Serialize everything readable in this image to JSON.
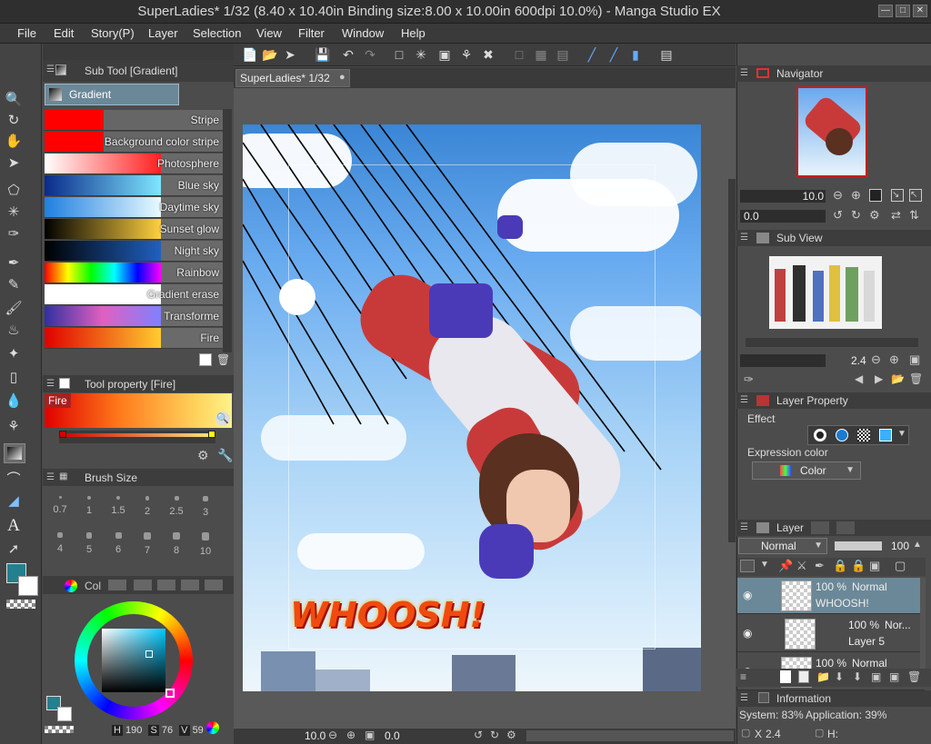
{
  "window": {
    "title": "SuperLadies* 1/32 (8.40 x 10.40in Binding size:8.00 x 10.00in 600dpi 10.0%)  - Manga Studio EX"
  },
  "menu": [
    "File",
    "Edit",
    "Story(P)",
    "Layer",
    "Selection",
    "View",
    "Filter",
    "Window",
    "Help"
  ],
  "subtool": {
    "panel_title": "Sub Tool [Gradient]",
    "active": "Gradient",
    "gradients": [
      {
        "name": "Stripe",
        "colors": [
          "#ff0000",
          "#ff0000"
        ]
      },
      {
        "name": "Background color stripe",
        "colors": [
          "#ff0000",
          "#ff0000"
        ]
      },
      {
        "name": "Photosphere",
        "colors": [
          "#ffffff",
          "#ff2020"
        ]
      },
      {
        "name": "Blue sky",
        "colors": [
          "#0a2a8a",
          "#7fe6ff"
        ]
      },
      {
        "name": "Daytime sky",
        "colors": [
          "#1f7fe0",
          "#e8fbff"
        ]
      },
      {
        "name": "Sunset glow",
        "colors": [
          "#000000",
          "#ffd040"
        ]
      },
      {
        "name": "Night sky",
        "colors": [
          "#000000",
          "#2060c0"
        ]
      },
      {
        "name": "Rainbow",
        "colors": [
          "#ff0000",
          "#ffff00",
          "#00ff00",
          "#00ffff",
          "#0000ff",
          "#ff00ff"
        ]
      },
      {
        "name": "Gradient erase",
        "colors": [
          "#ffffff",
          "#ffffff"
        ]
      },
      {
        "name": "Transforme",
        "colors": [
          "#3030a0",
          "#e060c0",
          "#8080ff"
        ]
      },
      {
        "name": "Fire",
        "colors": [
          "#e00000",
          "#ffcc30"
        ]
      }
    ]
  },
  "tool_property": {
    "panel_title": "Tool property [Fire]",
    "gradient_name": "Fire"
  },
  "brush_size": {
    "panel_title": "Brush Size",
    "sizes": [
      "0.7",
      "1",
      "1.5",
      "2",
      "2.5",
      "3",
      "4",
      "5",
      "6",
      "7",
      "8",
      "10"
    ]
  },
  "color_panel": {
    "tab_label": "Col",
    "hue": "190",
    "saturation": "76",
    "value": "59",
    "h_label": "H",
    "s_label": "S",
    "v_label": "V",
    "main_color": "#23808f",
    "sub_color": "#ffffff"
  },
  "document_tab": "SuperLadies* 1/32",
  "canvas": {
    "sfx_text": "WHOOSH!",
    "zoom": "10.0",
    "angle": "0.0"
  },
  "navigator": {
    "panel_title": "Navigator",
    "zoom": "10.0",
    "angle": "0.0"
  },
  "sub_view": {
    "panel_title": "Sub View",
    "zoom": "2.4"
  },
  "layer_property": {
    "panel_title": "Layer Property",
    "effect_label": "Effect",
    "expression_label": "Expression color",
    "expression_value": "Color"
  },
  "layers": {
    "panel_title": "Layer",
    "blend_mode": "Normal",
    "opacity": "100",
    "items": [
      {
        "opacity": "100 %",
        "mode": "Normal",
        "name": "WHOOSH!"
      },
      {
        "opacity": "100 %",
        "mode": "Nor...",
        "name": "Layer 5"
      },
      {
        "opacity": "100 %",
        "mode": "Normal",
        "name": ""
      }
    ]
  },
  "information": {
    "panel_title": "Information",
    "system": "System: 83%",
    "application": "Application: 39%",
    "x_label": "X",
    "x_value": "2.4",
    "h_label": "H:"
  }
}
